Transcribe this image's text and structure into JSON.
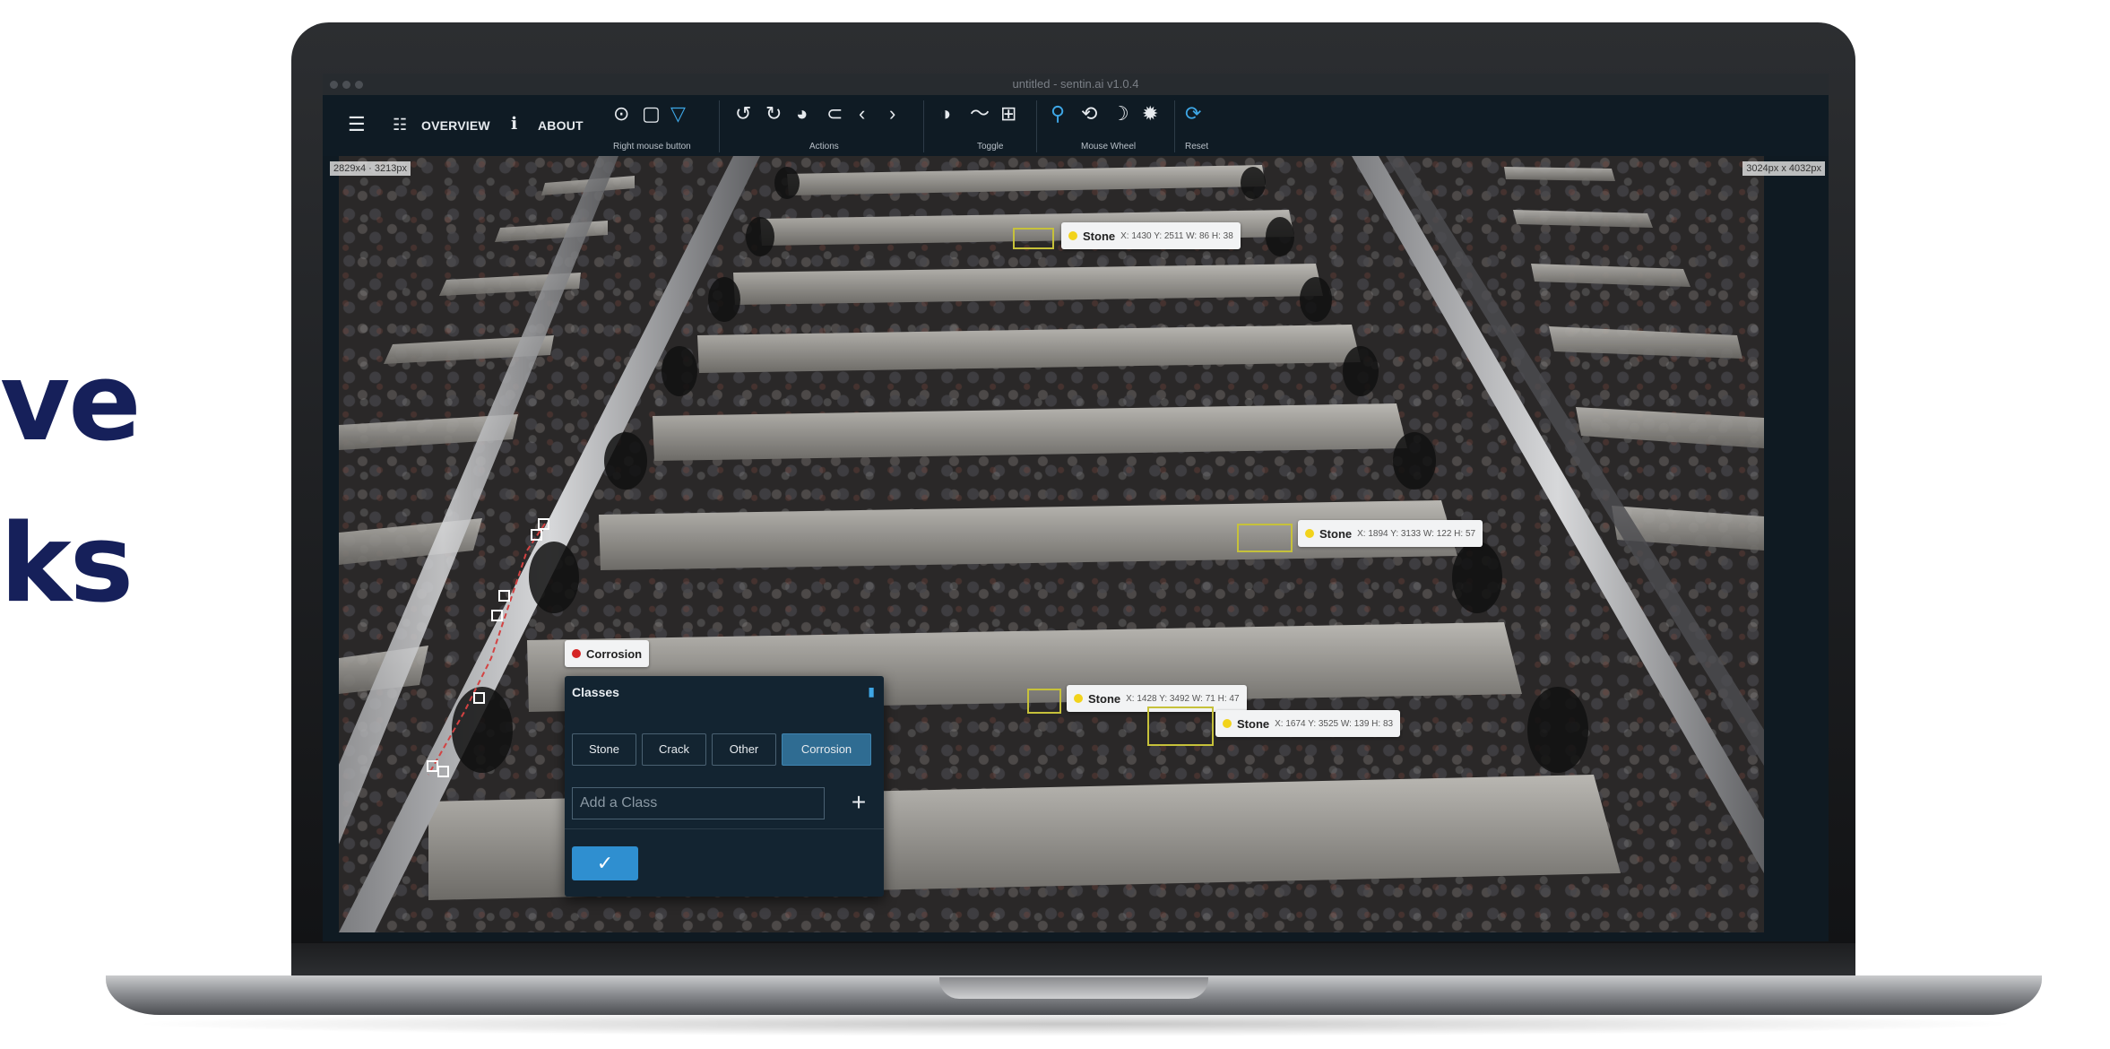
{
  "marketing": {
    "line1": "ve",
    "line2": "ks"
  },
  "window": {
    "title": "untitled - sentin.ai v1.0.4"
  },
  "toolbar": {
    "menu_icon": "hamburger-menu-icon",
    "overview_label": "OVERVIEW",
    "about_label": "ABOUT",
    "right_mouse_caption": "Right mouse button",
    "actions_caption": "Actions",
    "toggle_caption": "Toggle",
    "mouse_wheel_caption": "Mouse Wheel",
    "reset_caption": "Reset"
  },
  "canvas": {
    "left_tag": "2829x4 · 3213px",
    "right_tag": "3024px x 4032px"
  },
  "annotations": [
    {
      "class": "Stone",
      "meta": "X: 1430 Y: 2511 W: 86 H: 38"
    },
    {
      "class": "Stone",
      "meta": "X: 1894 Y: 3133 W: 122 H: 57"
    },
    {
      "class": "Stone",
      "meta": "X: 1428 Y: 3492 W: 71 H: 47"
    },
    {
      "class": "Stone",
      "meta": "X: 1674 Y: 3525 W: 139 H: 83"
    }
  ],
  "corrosion_label": "Corrosion",
  "popup": {
    "title": "Classes",
    "classes": [
      "Stone",
      "Crack",
      "Other",
      "Corrosion"
    ],
    "selected": "Corrosion",
    "input_placeholder": "Add a Class",
    "add_label": "+",
    "confirm_label": "✓"
  },
  "colors": {
    "toolbar_bg": "#0f1b24",
    "accent": "#3ea7e6",
    "stone_dot": "#f2d31b",
    "corrosion_dot": "#d52424",
    "marketing_text": "#16205a"
  }
}
